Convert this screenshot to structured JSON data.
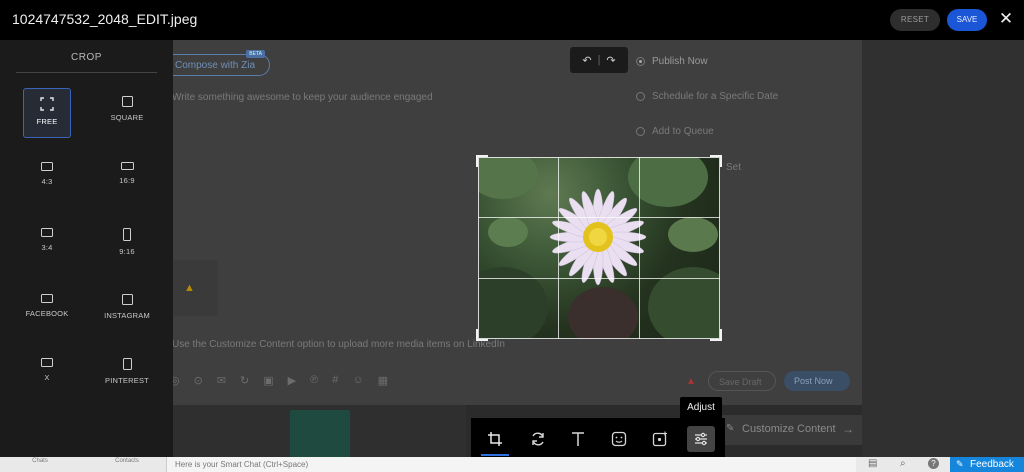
{
  "header": {
    "file_title": "1024747532_2048_EDIT.jpeg",
    "reset_label": "RESET",
    "save_label": "SAVE",
    "close_glyph": "✕"
  },
  "crop_panel": {
    "heading": "CROP",
    "options": [
      {
        "label": "FREE",
        "icon": "free-crop-icon",
        "selected": true
      },
      {
        "label": "SQUARE",
        "icon": "square-ratio-icon"
      },
      {
        "label": "4:3",
        "icon": "ratio-4-3-icon"
      },
      {
        "label": "16:9",
        "icon": "ratio-16-9-icon"
      },
      {
        "label": "3:4",
        "icon": "ratio-3-4-icon"
      },
      {
        "label": "9:16",
        "icon": "ratio-9-16-icon"
      },
      {
        "label": "FACEBOOK",
        "icon": "facebook-ratio-icon"
      },
      {
        "label": "INSTAGRAM",
        "icon": "instagram-ratio-icon"
      },
      {
        "label": "X",
        "icon": "x-ratio-icon"
      },
      {
        "label": "PINTEREST",
        "icon": "pinterest-ratio-icon"
      }
    ]
  },
  "background": {
    "compose_pill": "Compose with Zia",
    "compose_badge": "BETA",
    "placeholder_text": "Write something awesome to keep your audience engaged",
    "publish_now": "Publish Now",
    "schedule": "Schedule for a Specific Date",
    "add_queue": "Add to Queue",
    "set_label": "Set",
    "upload_hint": "Use the Customize Content option to upload more media items on LinkedIn",
    "customize": "Customize Content",
    "publish_btn": "Post Now",
    "draft_btn": "Save Draft"
  },
  "toolbar": {
    "tools": [
      "crop-icon",
      "rotate-icon",
      "text-icon",
      "sticker-icon",
      "frame-icon",
      "adjust-icon"
    ],
    "active": "crop-icon",
    "tooltip": "Adjust"
  },
  "statusbar": {
    "chats": "Chats",
    "contacts": "Contacts",
    "smart_chat_placeholder": "Here is your Smart Chat (Ctrl+Space)",
    "feedback": "Feedback"
  },
  "colors": {
    "accent": "#1a56d6",
    "feedback": "#1586dc",
    "selected_border": "#3a64b8"
  }
}
